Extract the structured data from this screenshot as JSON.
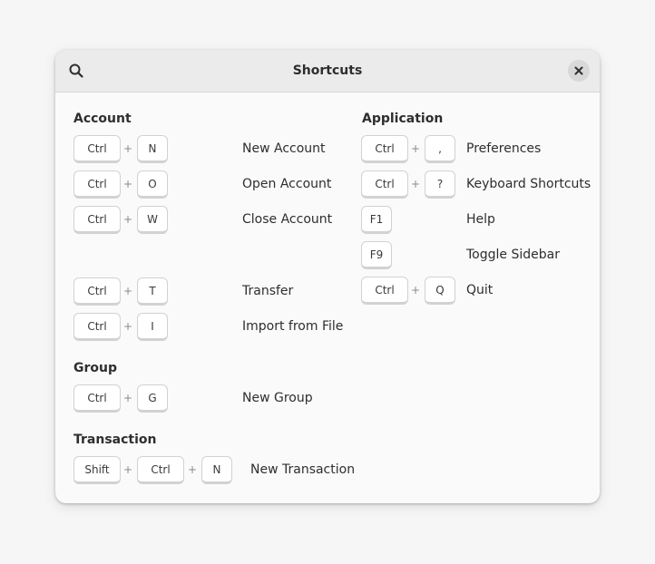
{
  "dialog": {
    "title": "Shortcuts"
  },
  "icons": {
    "search": "search-icon",
    "close": "close-icon"
  },
  "plus": "+",
  "sections": {
    "account": {
      "title": "Account",
      "shortcuts": [
        {
          "keys": [
            "Ctrl",
            "N"
          ],
          "label": "New Account"
        },
        {
          "keys": [
            "Ctrl",
            "O"
          ],
          "label": "Open Account"
        },
        {
          "keys": [
            "Ctrl",
            "W"
          ],
          "label": "Close Account"
        },
        {
          "keys": [
            "Ctrl",
            "T"
          ],
          "label": "Transfer"
        },
        {
          "keys": [
            "Ctrl",
            "I"
          ],
          "label": "Import from File"
        }
      ]
    },
    "group": {
      "title": "Group",
      "shortcuts": [
        {
          "keys": [
            "Ctrl",
            "G"
          ],
          "label": "New Group"
        }
      ]
    },
    "transaction": {
      "title": "Transaction",
      "shortcuts": [
        {
          "keys": [
            "Shift",
            "Ctrl",
            "N"
          ],
          "label": "New Transaction"
        }
      ]
    },
    "application": {
      "title": "Application",
      "shortcuts": [
        {
          "keys": [
            "Ctrl",
            ","
          ],
          "label": "Preferences"
        },
        {
          "keys": [
            "Ctrl",
            "?"
          ],
          "label": "Keyboard Shortcuts"
        },
        {
          "keys": [
            "F1"
          ],
          "label": "Help"
        },
        {
          "keys": [
            "F9"
          ],
          "label": "Toggle Sidebar"
        },
        {
          "keys": [
            "Ctrl",
            "Q"
          ],
          "label": "Quit"
        }
      ]
    }
  }
}
